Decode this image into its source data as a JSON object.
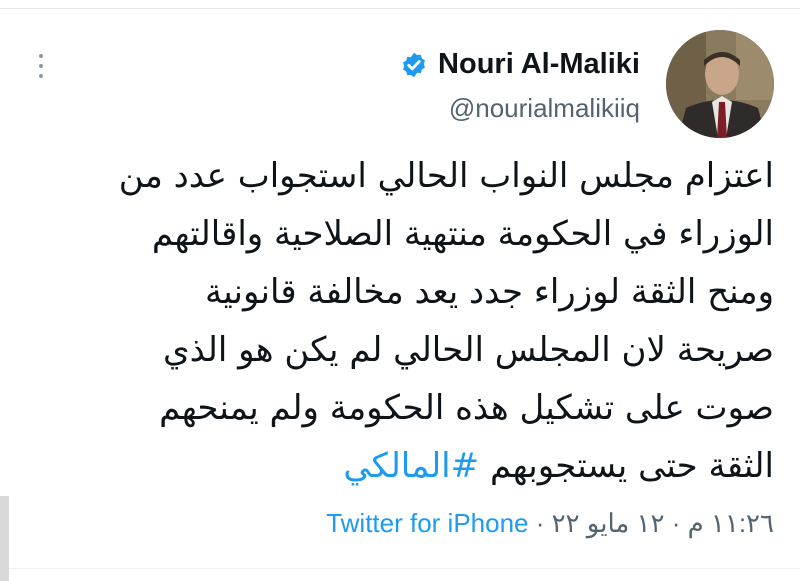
{
  "tweet": {
    "author_name": "Nouri Al-Maliki",
    "handle": "@nourialmalikiiq",
    "verified": true,
    "lines": [
      "اعتزام مجلس النواب الحالي استجواب عدد من",
      "الوزراء في الحكومة منتهية الصلاحية واقالتهم",
      "ومنح الثقة لوزراء جدد يعد مخالفة قانونية",
      "صريحة لان المجلس  الحالي لم يكن هو الذي",
      "صوت على تشكيل هذه الحكومة ولم يمنحهم",
      "الثقة حتى يستجوبهم"
    ],
    "hashtag": "#المالكي",
    "timestamp": "١١:٢٦ م · ١٢ مايو ٢٢",
    "separator": " · ",
    "source": "Twitter for iPhone"
  },
  "colors": {
    "text": "#0f1419",
    "secondary": "#536471",
    "link": "#1d9bf0",
    "verified": "#1d9bf0"
  },
  "icons": {
    "verified": "verified-badge-icon",
    "more": "more-options-icon"
  }
}
